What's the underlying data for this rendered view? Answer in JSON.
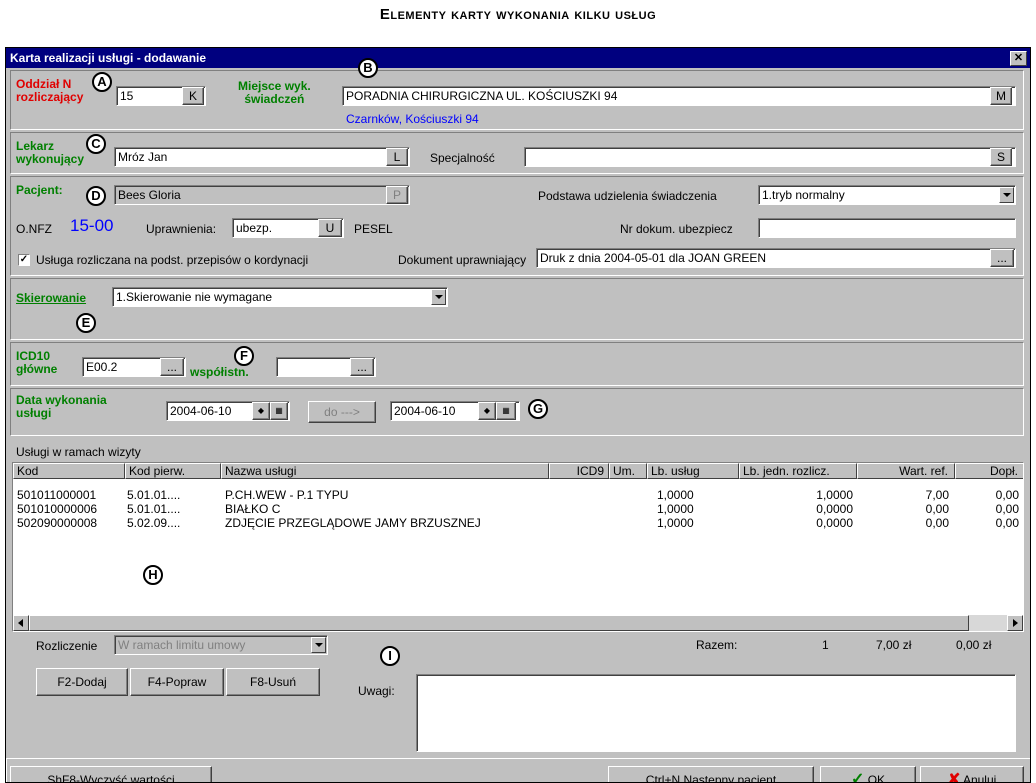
{
  "page_title": "Elementy karty wykonania kilku usług",
  "window": {
    "title": "Karta realizacji usługi - dodawanie",
    "close": "✕"
  },
  "markers": [
    "A",
    "B",
    "C",
    "D",
    "E",
    "F",
    "G",
    "H",
    "I"
  ],
  "oddzial": {
    "label_line1": "Oddział N",
    "label_line2": "rozliczający",
    "value": "15",
    "btn": "K"
  },
  "miejsce": {
    "label_line1": "Miejsce wyk.",
    "label_line2": "świadczeń",
    "value": "PORADNIA CHIRURGICZNA UL. KOŚCIUSZKI 94",
    "btn": "M",
    "address": "Czarnków, Kościuszki 94"
  },
  "lekarz": {
    "label_line1": "Lekarz",
    "label_line2": "wykonujący",
    "value": "Mróz Jan",
    "btn": "L"
  },
  "specjalnosc": {
    "label": "Specjalność",
    "value": "",
    "btn": "S"
  },
  "pacjent": {
    "label": "Pacjent:",
    "value": "Bees Gloria",
    "btn": "P"
  },
  "podstawa": {
    "label": "Podstawa udzielenia świadczenia",
    "value": "1.tryb normalny"
  },
  "onfz": {
    "label": "O.NFZ",
    "value": "15-00"
  },
  "uprawnienia": {
    "label": "Uprawnienia:",
    "value": "ubezp.",
    "btn": "U"
  },
  "pesel": {
    "label": "PESEL"
  },
  "nr_dokum": {
    "label": "Nr dokum. ubezpiecz",
    "value": ""
  },
  "kordynacja": {
    "label": "Usługa rozliczana na podst. przepisów o kordynacji",
    "checked": true,
    "mark": "✓"
  },
  "dokument": {
    "label": "Dokument uprawniający",
    "value": "Druk  z dnia 2004-05-01 dla JOAN GREEN",
    "btn": "..."
  },
  "skierowanie": {
    "label": "Skierowanie",
    "value": "1.Skierowanie nie wymagane"
  },
  "icd10": {
    "label_line1": "ICD10",
    "label_line2": "główne",
    "value": "E00.2",
    "btn": "...",
    "wsp_label": "współistn.",
    "wsp_value": "",
    "wsp_btn": "..."
  },
  "data_wyk": {
    "label_line1": "Data wykonania",
    "label_line2": "usługi",
    "from": "2004-06-10",
    "to_btn": "do --->",
    "to": "2004-06-10"
  },
  "uslugi": {
    "title": "Usługi w ramach wizyty",
    "columns": [
      "Kod",
      "Kod pierw.",
      "Nazwa usługi",
      "ICD9",
      "Um.",
      "Lb. usług",
      "Lb. jedn. rozlicz.",
      "Wart. ref.",
      "Dopł."
    ],
    "rows": [
      [
        "501011000001",
        "5.01.01....",
        "P.CH.WEW - P.1 TYPU",
        "",
        "",
        "1,0000",
        "1,0000",
        "7,00",
        "0,00"
      ],
      [
        "501010000006",
        "5.01.01....",
        "BIAŁKO C",
        "",
        "",
        "1,0000",
        "0,0000",
        "0,00",
        "0,00"
      ],
      [
        "502090000008",
        "5.02.09....",
        "ZDJĘCIE PRZEGLĄDOWE JAMY BRZUSZNEJ",
        "",
        "",
        "1,0000",
        "0,0000",
        "0,00",
        "0,00"
      ]
    ]
  },
  "rozliczenie": {
    "label": "Rozliczenie",
    "value": "W ramach limitu umowy"
  },
  "razem": {
    "label": "Razem:",
    "count": "1",
    "sum1": "7,00 zł",
    "sum2": "0,00 zł"
  },
  "buttons": {
    "dodaj": "F2-Dodaj",
    "popraw": "F4-Popraw",
    "usun": "F8-Usuń"
  },
  "uwagi": {
    "label": "Uwagi:",
    "value": ""
  },
  "footer": {
    "wyczysc": "ShF8-Wyczyść wartości",
    "nastepny": "Ctrl+N Następny pacjent",
    "ok": "OK",
    "anuluj": "Anuluj"
  },
  "colors": {
    "titlebar": "#00007f",
    "label_green": "#008000",
    "label_red": "#e00000",
    "onfz_blue": "#0000ff",
    "address_blue": "#0000ff"
  }
}
